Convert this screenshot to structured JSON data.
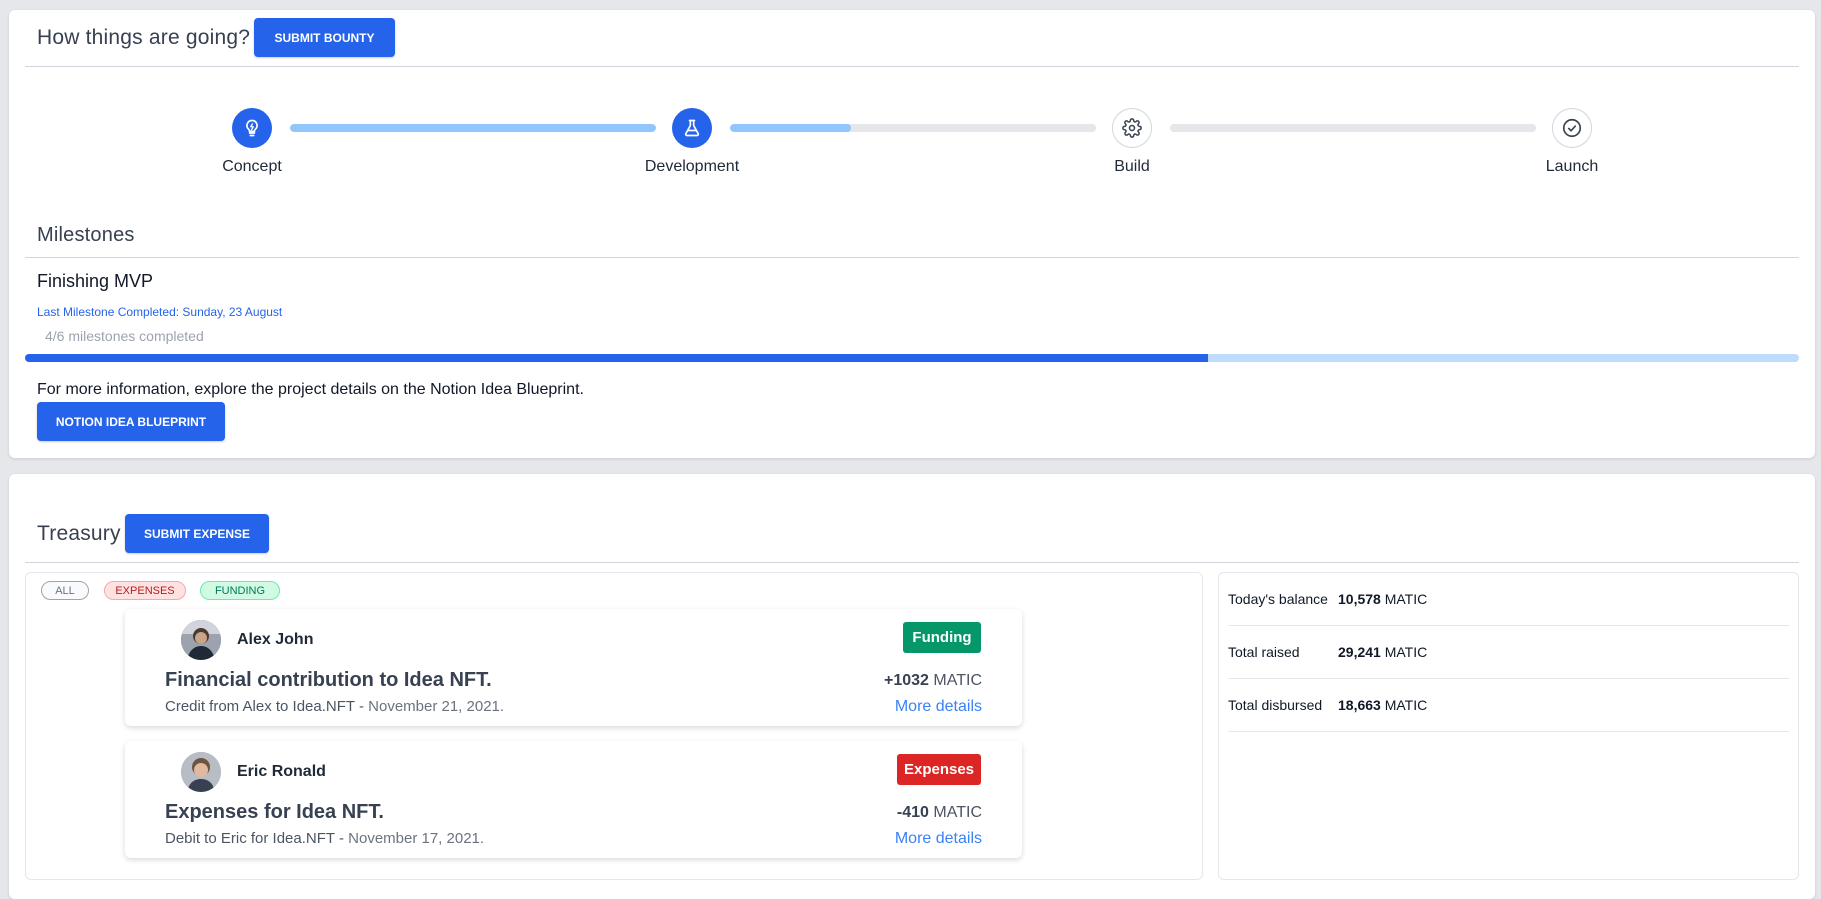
{
  "progress": {
    "title": "How things are going?",
    "submit_bounty_label": "SUBMIT BOUNTY",
    "steps": [
      {
        "label": "Concept",
        "state": "done",
        "icon": "lightbulb-icon"
      },
      {
        "label": "Development",
        "state": "done",
        "icon": "flask-icon"
      },
      {
        "label": "Build",
        "state": "pending",
        "icon": "gear-icon"
      },
      {
        "label": "Launch",
        "state": "pending",
        "icon": "check-circle-icon"
      }
    ],
    "connector_progress": [
      1.0,
      0.33,
      0.0
    ]
  },
  "milestones": {
    "title": "Milestones",
    "current": "Finishing MVP",
    "last_completed": "Last Milestone Completed: Sunday, 23 August",
    "count_text": "4/6 milestones completed",
    "completed": 4,
    "total": 6,
    "info_text": "For more information, explore the project details on the Notion Idea Blueprint.",
    "notion_button_label": "NOTION IDEA BLUEPRINT"
  },
  "treasury": {
    "title": "Treasury",
    "submit_expense_label": "SUBMIT EXPENSE",
    "filters": [
      {
        "label": "ALL",
        "color": "#6b7280",
        "bg": "#f9fafb",
        "border": "#9ca3af"
      },
      {
        "label": "EXPENSES",
        "color": "#b91c1c",
        "bg": "#fee2e2",
        "border": "#fca5a5"
      },
      {
        "label": "FUNDING",
        "color": "#047857",
        "bg": "#d1fae5",
        "border": "#6ee7b7"
      }
    ],
    "transactions": [
      {
        "name": "Alex John",
        "badge": "Funding",
        "badge_color": "#059669",
        "title": "Financial contribution to Idea NFT.",
        "description": "Credit from Alex to Idea.NFT",
        "separator": " - ",
        "date": "November 21, 2021.",
        "amount": "+1032",
        "currency": "MATIC",
        "more": "More details"
      },
      {
        "name": "Eric Ronald",
        "badge": "Expenses",
        "badge_color": "#dc2626",
        "title": "Expenses for Idea NFT.",
        "description": "Debit to Eric for Idea.NFT",
        "separator": " - ",
        "date": "November 17, 2021.",
        "amount": "-410",
        "currency": "MATIC",
        "more": "More details"
      }
    ],
    "stats": [
      {
        "label": "Today's balance",
        "value": "10,578",
        "unit": "MATIC"
      },
      {
        "label": "Total raised",
        "value": "29,241",
        "unit": "MATIC"
      },
      {
        "label": "Total disbursed",
        "value": "18,663",
        "unit": "MATIC"
      }
    ]
  },
  "colors": {
    "primary": "#2563eb",
    "light_blue": "#93c5fd",
    "track": "#e5e7eb"
  }
}
